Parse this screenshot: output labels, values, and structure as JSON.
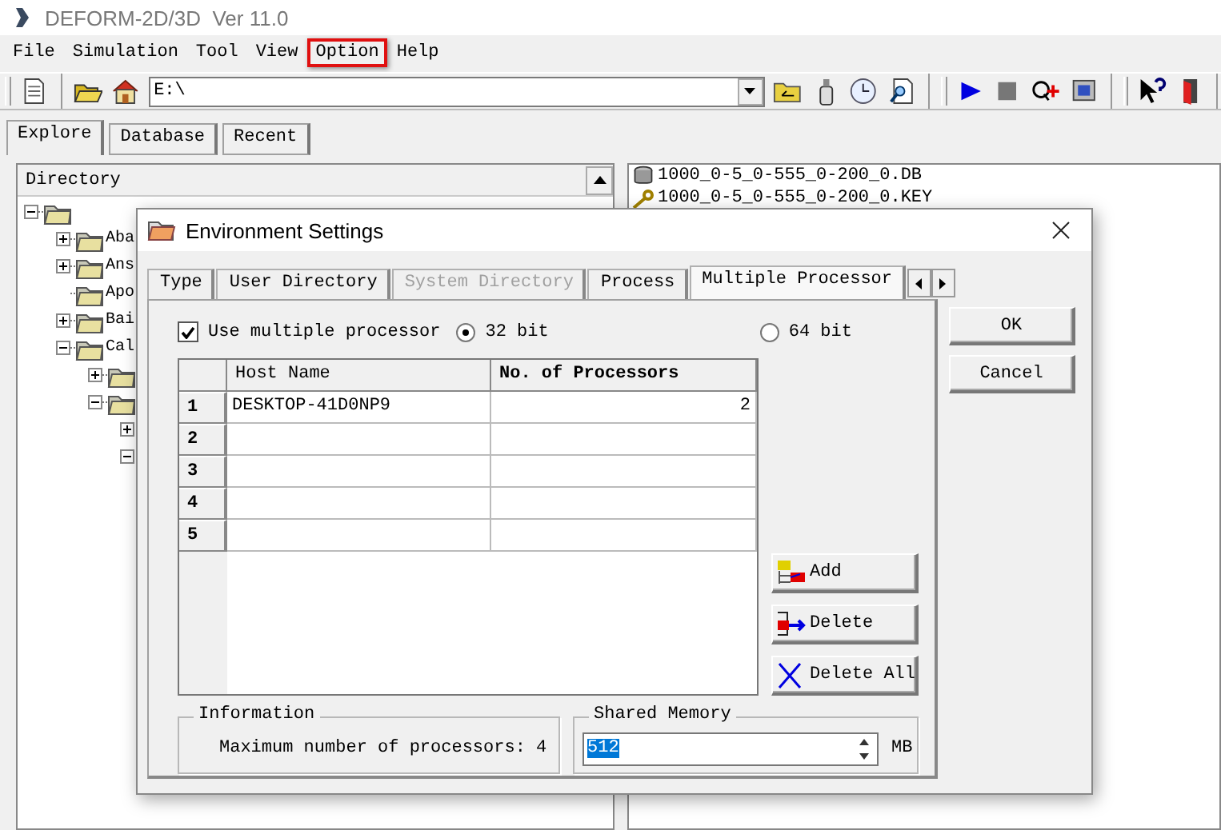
{
  "app_title": "DEFORM-2D/3D  Ver 11.0",
  "menu": [
    {
      "label": "File",
      "highlighted": false
    },
    {
      "label": "Simulation",
      "highlighted": false
    },
    {
      "label": "Tool",
      "highlighted": false
    },
    {
      "label": "View",
      "highlighted": false
    },
    {
      "label": "Option",
      "highlighted": true
    },
    {
      "label": "Help",
      "highlighted": false
    }
  ],
  "toolbar": {
    "path": "E:\\"
  },
  "explorer_tabs": [
    {
      "label": "Explore",
      "selected": true
    },
    {
      "label": "Database",
      "selected": false
    },
    {
      "label": "Recent",
      "selected": false
    }
  ],
  "directory": {
    "header": "Directory",
    "tree": [
      {
        "expanded": true,
        "children": [
          {
            "label": "Aba",
            "expanded": false
          },
          {
            "label": "Ans",
            "expanded": false
          },
          {
            "label": "Apo"
          },
          {
            "label": "Bai",
            "expanded": false
          },
          {
            "label": "Cal",
            "expanded": true,
            "children": [
              {
                "expanded": false
              },
              {
                "expanded": true,
                "children": [
                  {
                    "expanded": false
                  },
                  {
                    "expanded": true
                  }
                ]
              }
            ]
          }
        ]
      }
    ]
  },
  "files": [
    {
      "name": "1000_0-5_0-555_0-200_0.DB",
      "kind": "database"
    },
    {
      "name": "1000_0-5_0-555_0-200_0.KEY",
      "kind": "key"
    }
  ],
  "dialog": {
    "title": "Environment Settings",
    "tabs": [
      {
        "label": "Type",
        "selected": false,
        "disabled": false
      },
      {
        "label": "User Directory",
        "selected": false,
        "disabled": false
      },
      {
        "label": "System Directory",
        "selected": false,
        "disabled": true
      },
      {
        "label": "Process",
        "selected": false,
        "disabled": false
      },
      {
        "label": "Multiple Processor",
        "selected": true,
        "disabled": false
      }
    ],
    "buttons": [
      "OK",
      "Cancel"
    ],
    "use_multiple_processor": {
      "label": "Use multiple processor",
      "checked": true
    },
    "bits": [
      {
        "label": "32 bit",
        "selected": true
      },
      {
        "label": "64 bit",
        "selected": false
      }
    ],
    "grid": {
      "columns": [
        "Host Name",
        "No. of Processors"
      ],
      "rows": [
        {
          "number": "1",
          "host": "DESKTOP-41D0NP9",
          "processors": "2"
        },
        {
          "number": "2"
        },
        {
          "number": "3"
        },
        {
          "number": "4"
        },
        {
          "number": "5"
        }
      ]
    },
    "actions": [
      {
        "label": "Add",
        "kind": "add"
      },
      {
        "label": "Delete",
        "kind": "delete"
      },
      {
        "label": "Delete All",
        "kind": "delete_all"
      }
    ],
    "information": {
      "title": "Information",
      "text": "Maximum number of processors: 4"
    },
    "shared_memory": {
      "title": "Shared Memory",
      "value": "512",
      "unit": "MB"
    }
  }
}
